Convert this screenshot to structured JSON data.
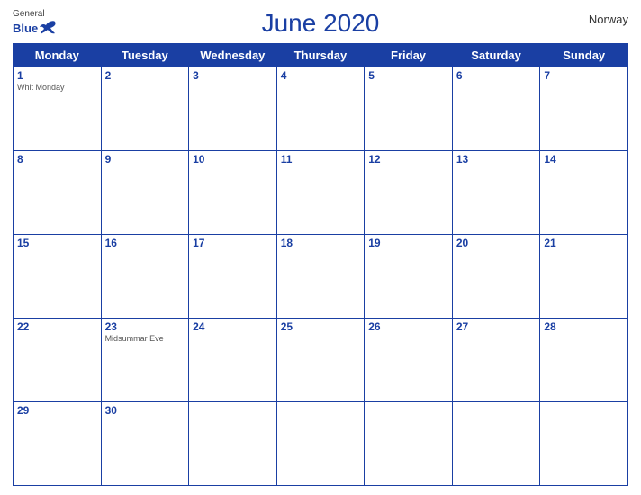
{
  "header": {
    "title": "June 2020",
    "country": "Norway",
    "logo": {
      "general": "General",
      "blue": "Blue"
    }
  },
  "weekdays": [
    "Monday",
    "Tuesday",
    "Wednesday",
    "Thursday",
    "Friday",
    "Saturday",
    "Sunday"
  ],
  "weeks": [
    [
      {
        "day": 1,
        "holiday": "Whit Monday"
      },
      {
        "day": 2,
        "holiday": null
      },
      {
        "day": 3,
        "holiday": null
      },
      {
        "day": 4,
        "holiday": null
      },
      {
        "day": 5,
        "holiday": null
      },
      {
        "day": 6,
        "holiday": null
      },
      {
        "day": 7,
        "holiday": null
      }
    ],
    [
      {
        "day": 8,
        "holiday": null
      },
      {
        "day": 9,
        "holiday": null
      },
      {
        "day": 10,
        "holiday": null
      },
      {
        "day": 11,
        "holiday": null
      },
      {
        "day": 12,
        "holiday": null
      },
      {
        "day": 13,
        "holiday": null
      },
      {
        "day": 14,
        "holiday": null
      }
    ],
    [
      {
        "day": 15,
        "holiday": null
      },
      {
        "day": 16,
        "holiday": null
      },
      {
        "day": 17,
        "holiday": null
      },
      {
        "day": 18,
        "holiday": null
      },
      {
        "day": 19,
        "holiday": null
      },
      {
        "day": 20,
        "holiday": null
      },
      {
        "day": 21,
        "holiday": null
      }
    ],
    [
      {
        "day": 22,
        "holiday": null
      },
      {
        "day": 23,
        "holiday": "Midsummar Eve"
      },
      {
        "day": 24,
        "holiday": null
      },
      {
        "day": 25,
        "holiday": null
      },
      {
        "day": 26,
        "holiday": null
      },
      {
        "day": 27,
        "holiday": null
      },
      {
        "day": 28,
        "holiday": null
      }
    ],
    [
      {
        "day": 29,
        "holiday": null
      },
      {
        "day": 30,
        "holiday": null
      },
      {
        "day": null,
        "holiday": null
      },
      {
        "day": null,
        "holiday": null
      },
      {
        "day": null,
        "holiday": null
      },
      {
        "day": null,
        "holiday": null
      },
      {
        "day": null,
        "holiday": null
      }
    ]
  ]
}
